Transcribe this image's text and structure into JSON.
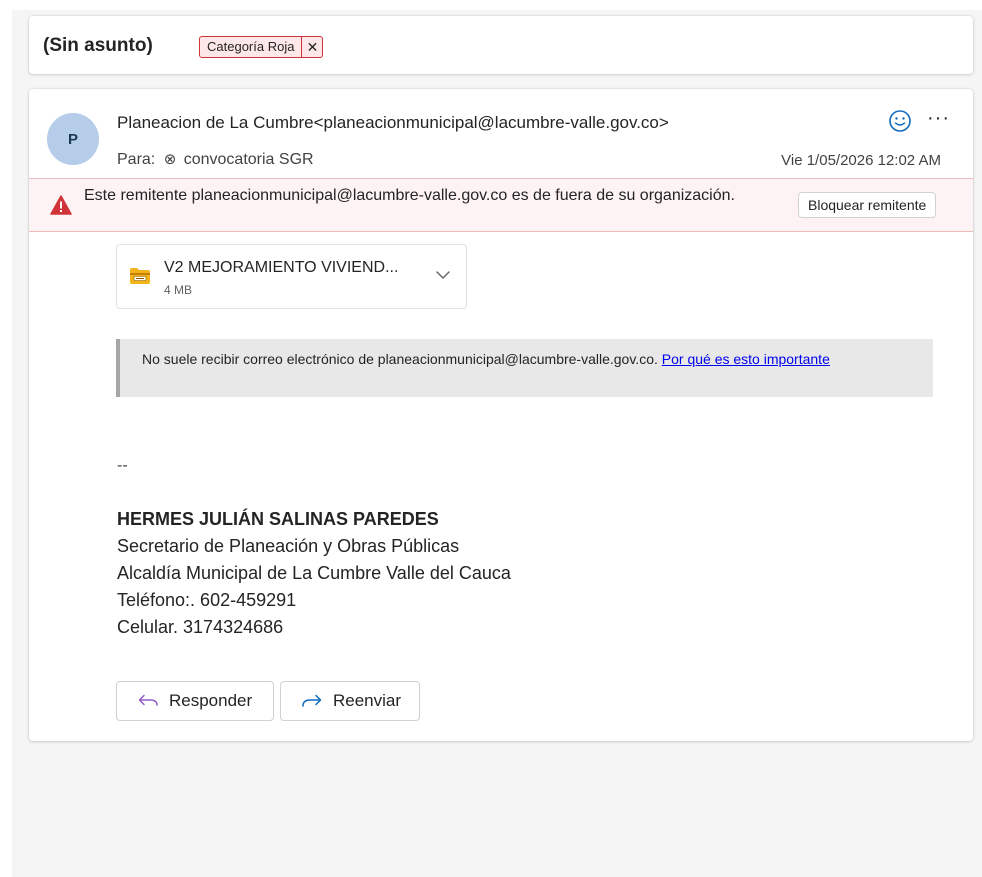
{
  "subject": {
    "title": "(Sin asunto)",
    "category": {
      "label": "Categoría Roja",
      "remove_glyph": "✕",
      "color": "#d13438"
    }
  },
  "message": {
    "avatar_initial": "P",
    "sender": "Planeacion de La Cumbre<planeacionmunicipal@lacumbre-valle.gov.co>",
    "to_label": "Para:",
    "recipient": "convocatoria SGR",
    "date": "Vie 1/05/2026 12:02 AM",
    "more_label": "···",
    "icons": {
      "reaction": "smiley-icon",
      "more": "more-options-icon",
      "recipient": "recipient-remove-icon",
      "warning": "warning-icon",
      "attachment": "archive-file-icon",
      "chevron": "chevron-down-icon",
      "reply": "reply-arrow-icon",
      "forward": "forward-arrow-icon"
    }
  },
  "warning": {
    "text": "Este remitente planeacionmunicipal@lacumbre-valle.gov.co es de fuera de su organización.",
    "block_label": "Bloquear remitente",
    "color": "#d13438"
  },
  "attachment": {
    "name": "V2 MEJORAMIENTO VIVIEND...",
    "size": "4 MB"
  },
  "notice": {
    "text": "No suele recibir correo electrónico de planeacionmunicipal@lacumbre-valle.gov.co. ",
    "link": "Por qué es esto importante"
  },
  "signature": {
    "dashes": "--",
    "name": "HERMES JULIÁN SALINAS PAREDES",
    "title": "Secretario de Planeación y Obras Públicas",
    "office": "Alcaldía Municipal de La Cumbre Valle del Cauca",
    "phone": "Teléfono:. 602-459291",
    "mobile": "Celular. 3174324686"
  },
  "actions": {
    "reply_label": "Responder",
    "forward_label": "Reenviar",
    "accent": "#0f6cbd"
  }
}
